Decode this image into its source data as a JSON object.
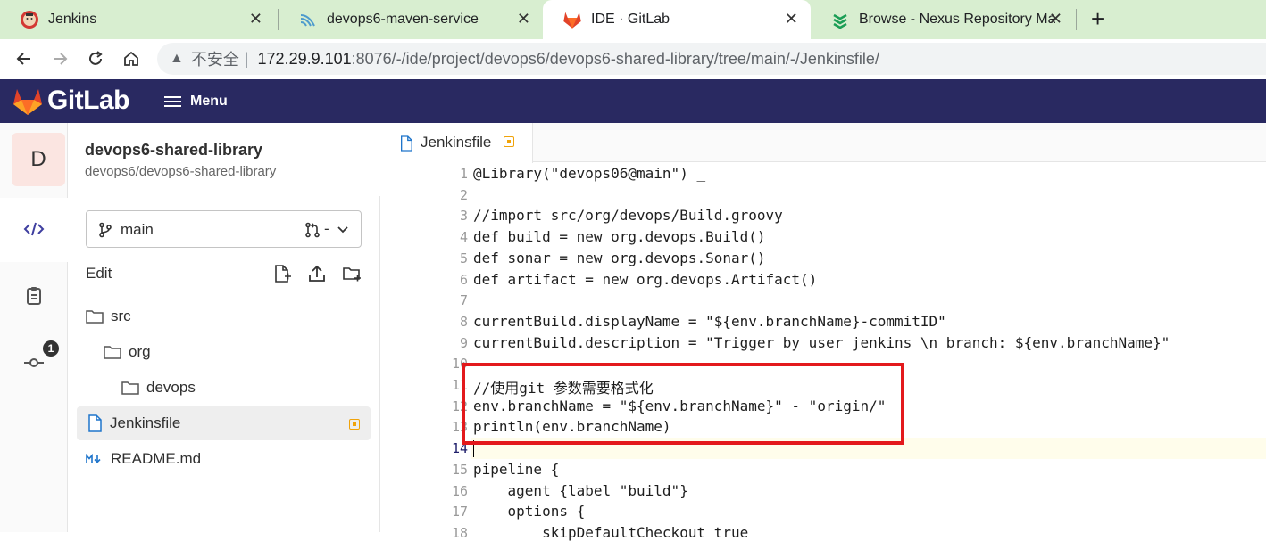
{
  "browser": {
    "tabs": [
      {
        "title": "Jenkins",
        "active": false
      },
      {
        "title": "devops6-maven-service",
        "active": false
      },
      {
        "title": "IDE · GitLab",
        "active": true
      },
      {
        "title": "Browse - Nexus Repository Ma",
        "active": false
      }
    ],
    "close_glyph": "✕",
    "new_tab_glyph": "+",
    "address": {
      "insecure_label": "不安全",
      "separator": "|",
      "host": "172.29.9.101",
      "path": ":8076/-/ide/project/devops6/devops6-shared-library/tree/main/-/Jenkinsfile/"
    },
    "icons": [
      "back-icon",
      "forward-icon",
      "reload-icon",
      "home-icon",
      "warning-icon"
    ]
  },
  "gitlab": {
    "brand": "GitLab",
    "menu_label": "Menu",
    "accent": "#292961"
  },
  "project": {
    "avatar_letter": "D",
    "name": "devops6-shared-library",
    "path": "devops6/devops6-shared-library",
    "branch": "main",
    "mr_value": "-",
    "edit_label": "Edit",
    "commit_badge": "1"
  },
  "tree": [
    {
      "name": "src",
      "type": "folder",
      "depth": 0
    },
    {
      "name": "org",
      "type": "folder",
      "depth": 1
    },
    {
      "name": "devops",
      "type": "folder",
      "depth": 2
    },
    {
      "name": "Jenkinsfile",
      "type": "file",
      "depth": 0,
      "selected": true,
      "modified": true
    },
    {
      "name": "README.md",
      "type": "markdown",
      "depth": 0
    }
  ],
  "editor": {
    "tab_name": "Jenkinsfile",
    "current_line": 14,
    "lines": [
      {
        "n": "1",
        "text": "@Library(\"devops06@main\") _"
      },
      {
        "n": "2",
        "text": ""
      },
      {
        "n": "3",
        "text": "//import src/org/devops/Build.groovy"
      },
      {
        "n": "4",
        "text": "def build = new org.devops.Build()"
      },
      {
        "n": "5",
        "text": "def sonar = new org.devops.Sonar()"
      },
      {
        "n": "6",
        "text": "def artifact = new org.devops.Artifact()"
      },
      {
        "n": "7",
        "text": ""
      },
      {
        "n": "8",
        "text": "currentBuild.displayName = \"${env.branchName}-commitID\""
      },
      {
        "n": "9",
        "text": "currentBuild.description = \"Trigger by user jenkins \\n branch: ${env.branchName}\""
      },
      {
        "n": "10",
        "text": ""
      },
      {
        "n": "11",
        "text": "//使用git 参数需要格式化"
      },
      {
        "n": "12",
        "text": "env.branchName = \"${env.branchName}\" - \"origin/\""
      },
      {
        "n": "13",
        "text": "println(env.branchName)"
      },
      {
        "n": "14",
        "text": ""
      },
      {
        "n": "15",
        "text": "pipeline {"
      },
      {
        "n": "16",
        "text": "    agent {label \"build\"}"
      },
      {
        "n": "17",
        "text": "    options {"
      },
      {
        "n": "18",
        "text": "        skipDefaultCheckout true"
      }
    ]
  },
  "colors": {
    "highlight_box": "#e3191c",
    "modified": "#f0a30a",
    "tabstrip": "#d8eed0"
  }
}
